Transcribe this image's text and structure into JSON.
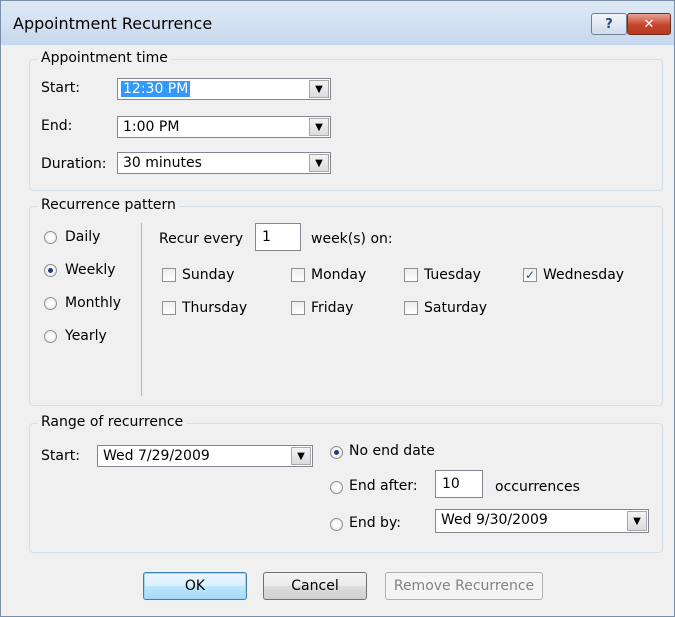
{
  "window": {
    "title": "Appointment Recurrence",
    "help_glyph": "?",
    "close_glyph": "✕"
  },
  "appointment_time": {
    "group_label": "Appointment time",
    "start_label": "Start:",
    "start_value": "12:30 PM",
    "end_label": "End:",
    "end_value": "1:00 PM",
    "duration_label": "Duration:",
    "duration_value": "30 minutes"
  },
  "recurrence_pattern": {
    "group_label": "Recurrence pattern",
    "frequencies": [
      {
        "label": "Daily",
        "selected": false
      },
      {
        "label": "Weekly",
        "selected": true
      },
      {
        "label": "Monthly",
        "selected": false
      },
      {
        "label": "Yearly",
        "selected": false
      }
    ],
    "recur_every_label": "Recur every",
    "recur_every_value": "1",
    "weeks_on_label": "week(s) on:",
    "days": [
      {
        "label": "Sunday",
        "checked": false
      },
      {
        "label": "Monday",
        "checked": false
      },
      {
        "label": "Tuesday",
        "checked": false
      },
      {
        "label": "Wednesday",
        "checked": true
      },
      {
        "label": "Thursday",
        "checked": false
      },
      {
        "label": "Friday",
        "checked": false
      },
      {
        "label": "Saturday",
        "checked": false
      }
    ]
  },
  "range": {
    "group_label": "Range of recurrence",
    "start_label": "Start:",
    "start_value": "Wed 7/29/2009",
    "no_end_label": "No end date",
    "end_after_label": "End after:",
    "end_after_value": "10",
    "occurrences_label": "occurrences",
    "end_by_label": "End by:",
    "end_by_value": "Wed 9/30/2009",
    "selected": "no_end"
  },
  "buttons": {
    "ok": "OK",
    "cancel": "Cancel",
    "remove": "Remove Recurrence"
  },
  "icons": {
    "dropdown": "▼",
    "check": "✓"
  },
  "colors": {
    "title_bg": "#d2e1f2",
    "selection": "#3399ff",
    "close_red": "#c6452c"
  }
}
